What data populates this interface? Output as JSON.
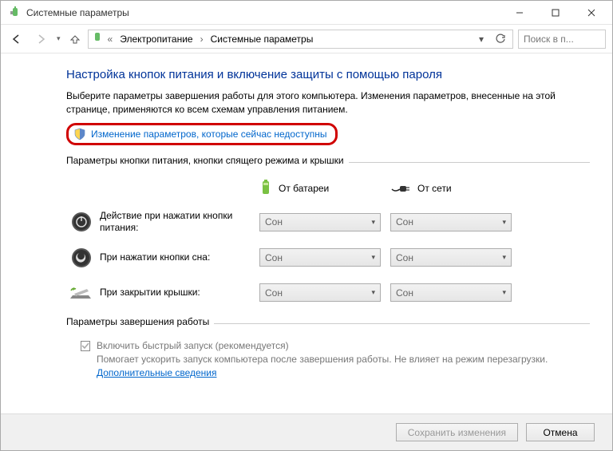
{
  "title": "Системные параметры",
  "breadcrumb": {
    "item1": "Электропитание",
    "item2": "Системные параметры"
  },
  "search": {
    "placeholder": "Поиск в п..."
  },
  "heading": "Настройка кнопок питания и включение защиты с помощью пароля",
  "description": "Выберите параметры завершения работы для этого компьютера. Изменения параметров, внесенные на этой странице, применяются ко всем схемам управления питанием.",
  "change_link": "Изменение параметров, которые сейчас недоступны",
  "group1_label": "Параметры кнопки питания, кнопки спящего режима и крышки",
  "col_battery": "От батареи",
  "col_plugged": "От сети",
  "rows": {
    "power": {
      "label": "Действие при нажатии кнопки питания:",
      "battery": "Сон",
      "plugged": "Сон"
    },
    "sleep": {
      "label": "При нажатии кнопки сна:",
      "battery": "Сон",
      "plugged": "Сон"
    },
    "lid": {
      "label": "При закрытии крышки:",
      "battery": "Сон",
      "plugged": "Сон"
    }
  },
  "group2_label": "Параметры завершения работы",
  "fast_startup": {
    "label": "Включить быстрый запуск (рекомендуется)",
    "desc": "Помогает ускорить запуск компьютера после завершения работы. Не влияет на режим перезагрузки. ",
    "link": "Дополнительные сведения"
  },
  "buttons": {
    "save": "Сохранить изменения",
    "cancel": "Отмена"
  }
}
